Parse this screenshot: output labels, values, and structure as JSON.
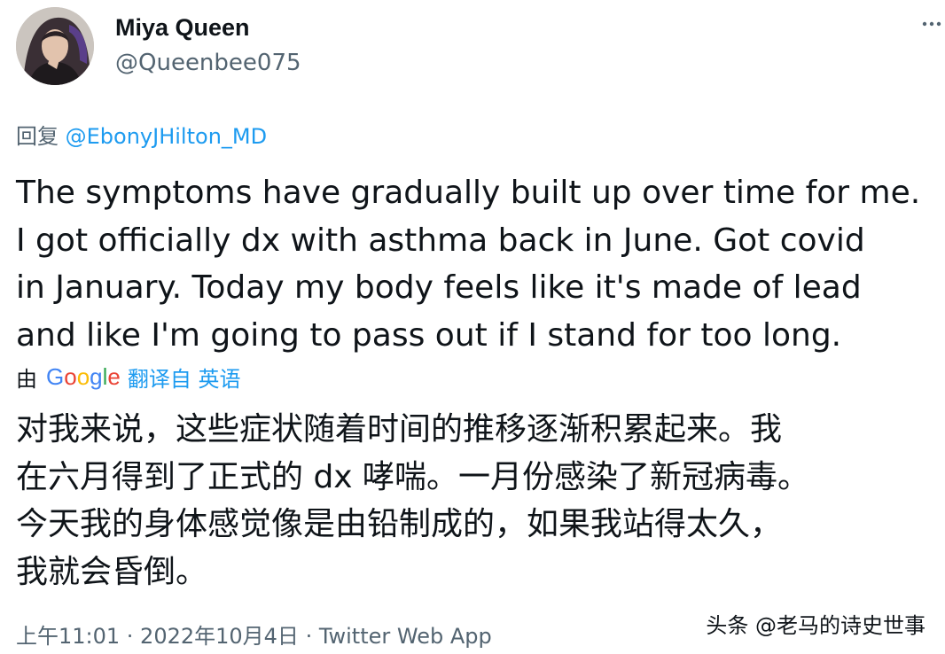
{
  "author": {
    "display_name": "Miya Queen",
    "handle": "@Queenbee075",
    "avatar_icon": "user-avatar-photo"
  },
  "reply": {
    "prefix": "回复",
    "mention": "@EbonyJHilton_MD"
  },
  "tweet": {
    "lines_en": [
      "The symptoms have gradually built up over time for me.",
      "I got officially dx with asthma back in June. Got covid",
      "in January. Today my body feels like it's made of lead",
      "and like I'm going to pass out if I stand for too long."
    ],
    "lines_zh": [
      "对我来说，这些症状随着时间的推移逐渐积累起来。我",
      "在六月得到了正式的 dx 哮喘。一月份感染了新冠病毒。",
      "今天我的身体感觉像是由铅制成的，如果我站得太久，",
      "我就会昏倒。"
    ]
  },
  "translation": {
    "by": "由",
    "provider": "Google",
    "action": "翻译自 英语"
  },
  "meta": {
    "timestamp": "上午11:01 · 2022年10月4日 · Twitter Web App"
  },
  "watermark": "头条 @老马的诗史世事",
  "colors": {
    "text_primary": "#0f1419",
    "text_secondary": "#536471",
    "link": "#1d9bf0"
  },
  "icons": {
    "more": "more-horizontal-icon"
  }
}
